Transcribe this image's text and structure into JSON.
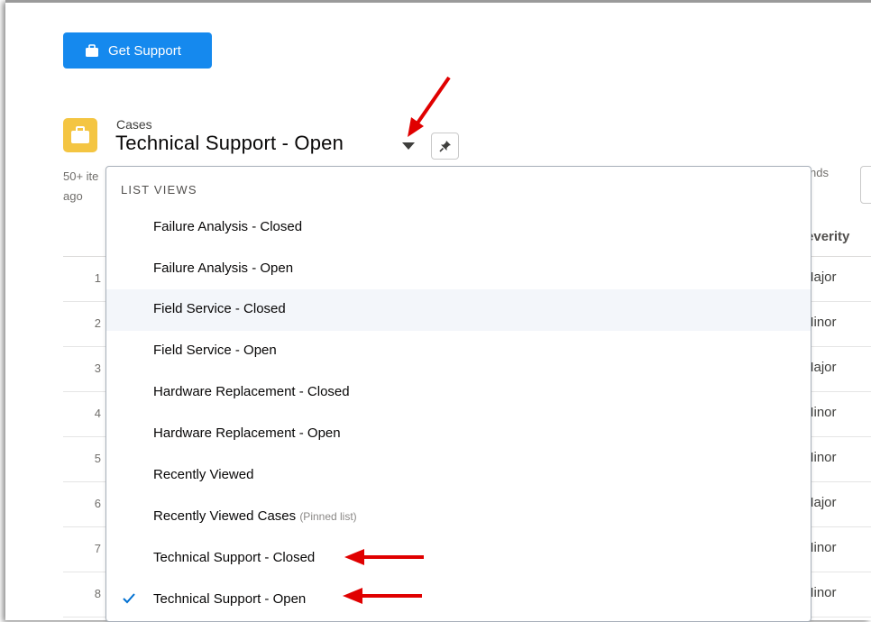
{
  "toolbar": {
    "get_support_label": "Get Support"
  },
  "header": {
    "object_label": "Cases",
    "view_title": "Technical Support - Open"
  },
  "meta": {
    "items_count_text": "50+ ite",
    "ago_text": "ago",
    "right_text": "nds"
  },
  "table": {
    "severity_header": "Severity",
    "rows": [
      {
        "num": "1",
        "severity": "Major"
      },
      {
        "num": "2",
        "severity": "Minor"
      },
      {
        "num": "3",
        "severity": "Major"
      },
      {
        "num": "4",
        "severity": "Minor"
      },
      {
        "num": "5",
        "severity": "Minor"
      },
      {
        "num": "6",
        "severity": "Major"
      },
      {
        "num": "7",
        "severity": "Minor"
      },
      {
        "num": "8",
        "severity": "Minor"
      }
    ]
  },
  "list_views": {
    "header": "LIST VIEWS",
    "items": [
      {
        "label": "Failure Analysis - Closed"
      },
      {
        "label": "Failure Analysis - Open"
      },
      {
        "label": "Field Service - Closed",
        "hovered": true
      },
      {
        "label": "Field Service - Open"
      },
      {
        "label": "Hardware Replacement - Closed"
      },
      {
        "label": "Hardware Replacement - Open"
      },
      {
        "label": "Recently Viewed"
      },
      {
        "label": "Recently Viewed Cases",
        "sublabel": "(Pinned list)"
      },
      {
        "label": "Technical Support - Closed"
      },
      {
        "label": "Technical Support - Open",
        "selected": true
      }
    ]
  },
  "colors": {
    "brand_button": "#1589ee",
    "case_icon": "#f4c542",
    "annotation_arrow": "#e00000",
    "check": "#0070d2"
  },
  "icons": {
    "button_icon": "briefcase-icon",
    "object_icon": "case-briefcase-icon",
    "caret": "caret-down-icon",
    "pin": "pin-icon",
    "check": "check-icon"
  }
}
